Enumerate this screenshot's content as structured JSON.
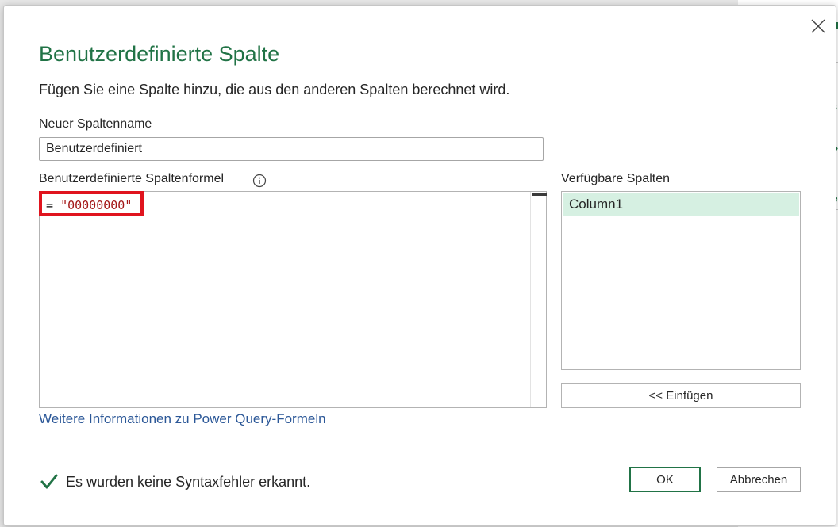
{
  "dialog": {
    "title": "Benutzerdefinierte Spalte",
    "subtitle": "Fügen Sie eine Spalte hinzu, die aus den anderen Spalten berechnet wird.",
    "column_name_label": "Neuer Spaltenname",
    "column_name_value": "Benutzerdefiniert",
    "formula_label": "Benutzerdefinierte Spaltenformel",
    "formula": {
      "operator": "= ",
      "string_literal": "\"00000000\""
    },
    "available_columns_label": "Verfügbare Spalten",
    "available_columns": [
      "Column1"
    ],
    "insert_button": "<< Einfügen",
    "learn_more_link": "Weitere Informationen zu Power Query-Formeln",
    "status_text": "Es wurden keine Syntaxfehler erkannt.",
    "ok_button": "OK",
    "cancel_button": "Abbrechen"
  },
  "colors": {
    "accent": "#217346",
    "highlight": "#e0141e",
    "selected_row": "#d6f0e2",
    "link": "#2b5797",
    "string_literal": "#a31515"
  },
  "icons": {
    "close": "close-icon",
    "info": "info-icon",
    "status": "checkmark-icon"
  }
}
